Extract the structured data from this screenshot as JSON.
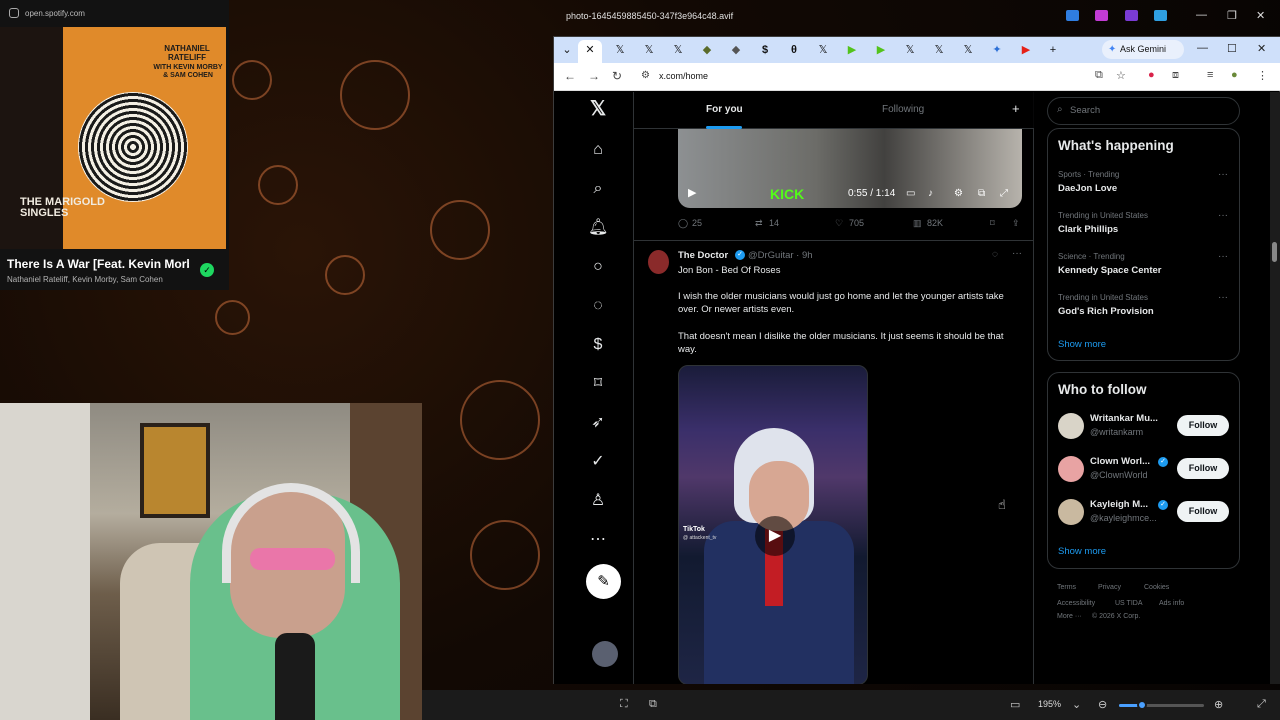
{
  "photo_viewer": {
    "title": "photo-1645459885450-347f3e964c48.avif",
    "zoom_level": "195%",
    "zoom_fraction": 0.27
  },
  "spotify": {
    "url": "open.spotify.com",
    "album_artist": "NATHANIEL RATELIFF",
    "album_with": "WITH KEVIN MORBY & SAM COHEN",
    "album_title": "THE MARIGOLD SINGLES",
    "track_title": "There Is A War [Feat. Kevin Morby & Sam Cohen]",
    "track_artists": "Nathaniel Rateliff, Kevin Morby, Sam Cohen",
    "saved_icon": "✓"
  },
  "browser": {
    "active_tab_icon": "✕",
    "tab_icons": [
      "𝕏",
      "𝕏",
      "𝕏",
      "◆",
      "◆",
      "$",
      "θ",
      "𝕏",
      "▶",
      "▶",
      "𝕏",
      "𝕏",
      "𝕏",
      "✦",
      "▶"
    ],
    "new_tab": "+",
    "ask_gemini": "Ask Gemini",
    "url": "x.com/home"
  },
  "x": {
    "tabs": {
      "for_you": "For you",
      "following": "Following"
    },
    "prev_tweet": {
      "video_time": "0:55 / 1:14",
      "kick": "KICK",
      "replies": "25",
      "reposts": "14",
      "likes": "705",
      "views": "82K"
    },
    "tweet": {
      "name": "The Doctor",
      "handle": "@DrGuitar · 9h",
      "line1": "Jon Bon - Bed Of Roses",
      "para1": "I wish the older musicians would just go home and let the younger artists take over. Or newer artists even.",
      "para2": "That doesn't mean I dislike the older musicians. It just seems it should be that way.",
      "tiktok": "TikTok",
      "tiktok_user": "@ attackent_tv"
    },
    "search_placeholder": "Search",
    "whats_happening": {
      "title": "What's happening",
      "trends": [
        {
          "meta": "Sports · Trending",
          "name": "DaeJon Love"
        },
        {
          "meta": "Trending in United States",
          "name": "Clark Phillips"
        },
        {
          "meta": "Science · Trending",
          "name": "Kennedy Space Center"
        },
        {
          "meta": "Trending in United States",
          "name": "God's Rich Provision"
        }
      ],
      "show_more": "Show more"
    },
    "who_to_follow": {
      "title": "Who to follow",
      "accounts": [
        {
          "name": "Writankar Mu...",
          "handle": "@writankarm",
          "follow": "Follow"
        },
        {
          "name": "Clown Worl...",
          "handle": "@ClownWorld",
          "follow": "Follow"
        },
        {
          "name": "Kayleigh M...",
          "handle": "@kayleighmce...",
          "follow": "Follow"
        }
      ],
      "show_more": "Show more"
    },
    "footer": {
      "terms": "Terms",
      "privacy": "Privacy",
      "cookies": "Cookies",
      "accessibility": "Accessibility",
      "tida": "US TIDA",
      "ads": "Ads info",
      "more": "More ···",
      "copyright": "© 2026 X Corp."
    }
  }
}
